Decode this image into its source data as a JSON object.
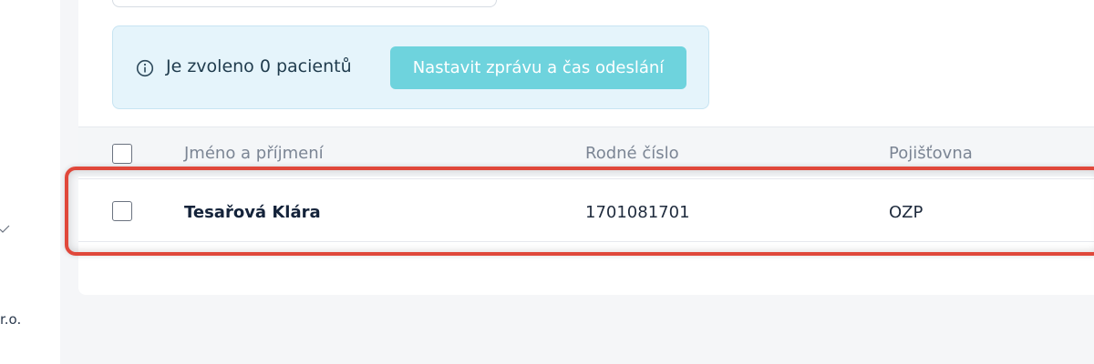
{
  "sidebar": {
    "company_fragment": "r.o."
  },
  "info_banner": {
    "text": "Je zvoleno 0 pacientů",
    "button_label": "Nastavit zprávu a čas odeslání"
  },
  "table": {
    "columns": [
      "Jméno a příjmení",
      "Rodné číslo",
      "Pojišťovna"
    ],
    "rows": [
      {
        "name": "Tesařová Klára",
        "birth_number": "1701081701",
        "insurer": "OZP"
      }
    ]
  },
  "colors": {
    "accent_button": "#6ed3dd",
    "info_background": "#e5f4fb",
    "highlight_border": "#e0483b"
  }
}
